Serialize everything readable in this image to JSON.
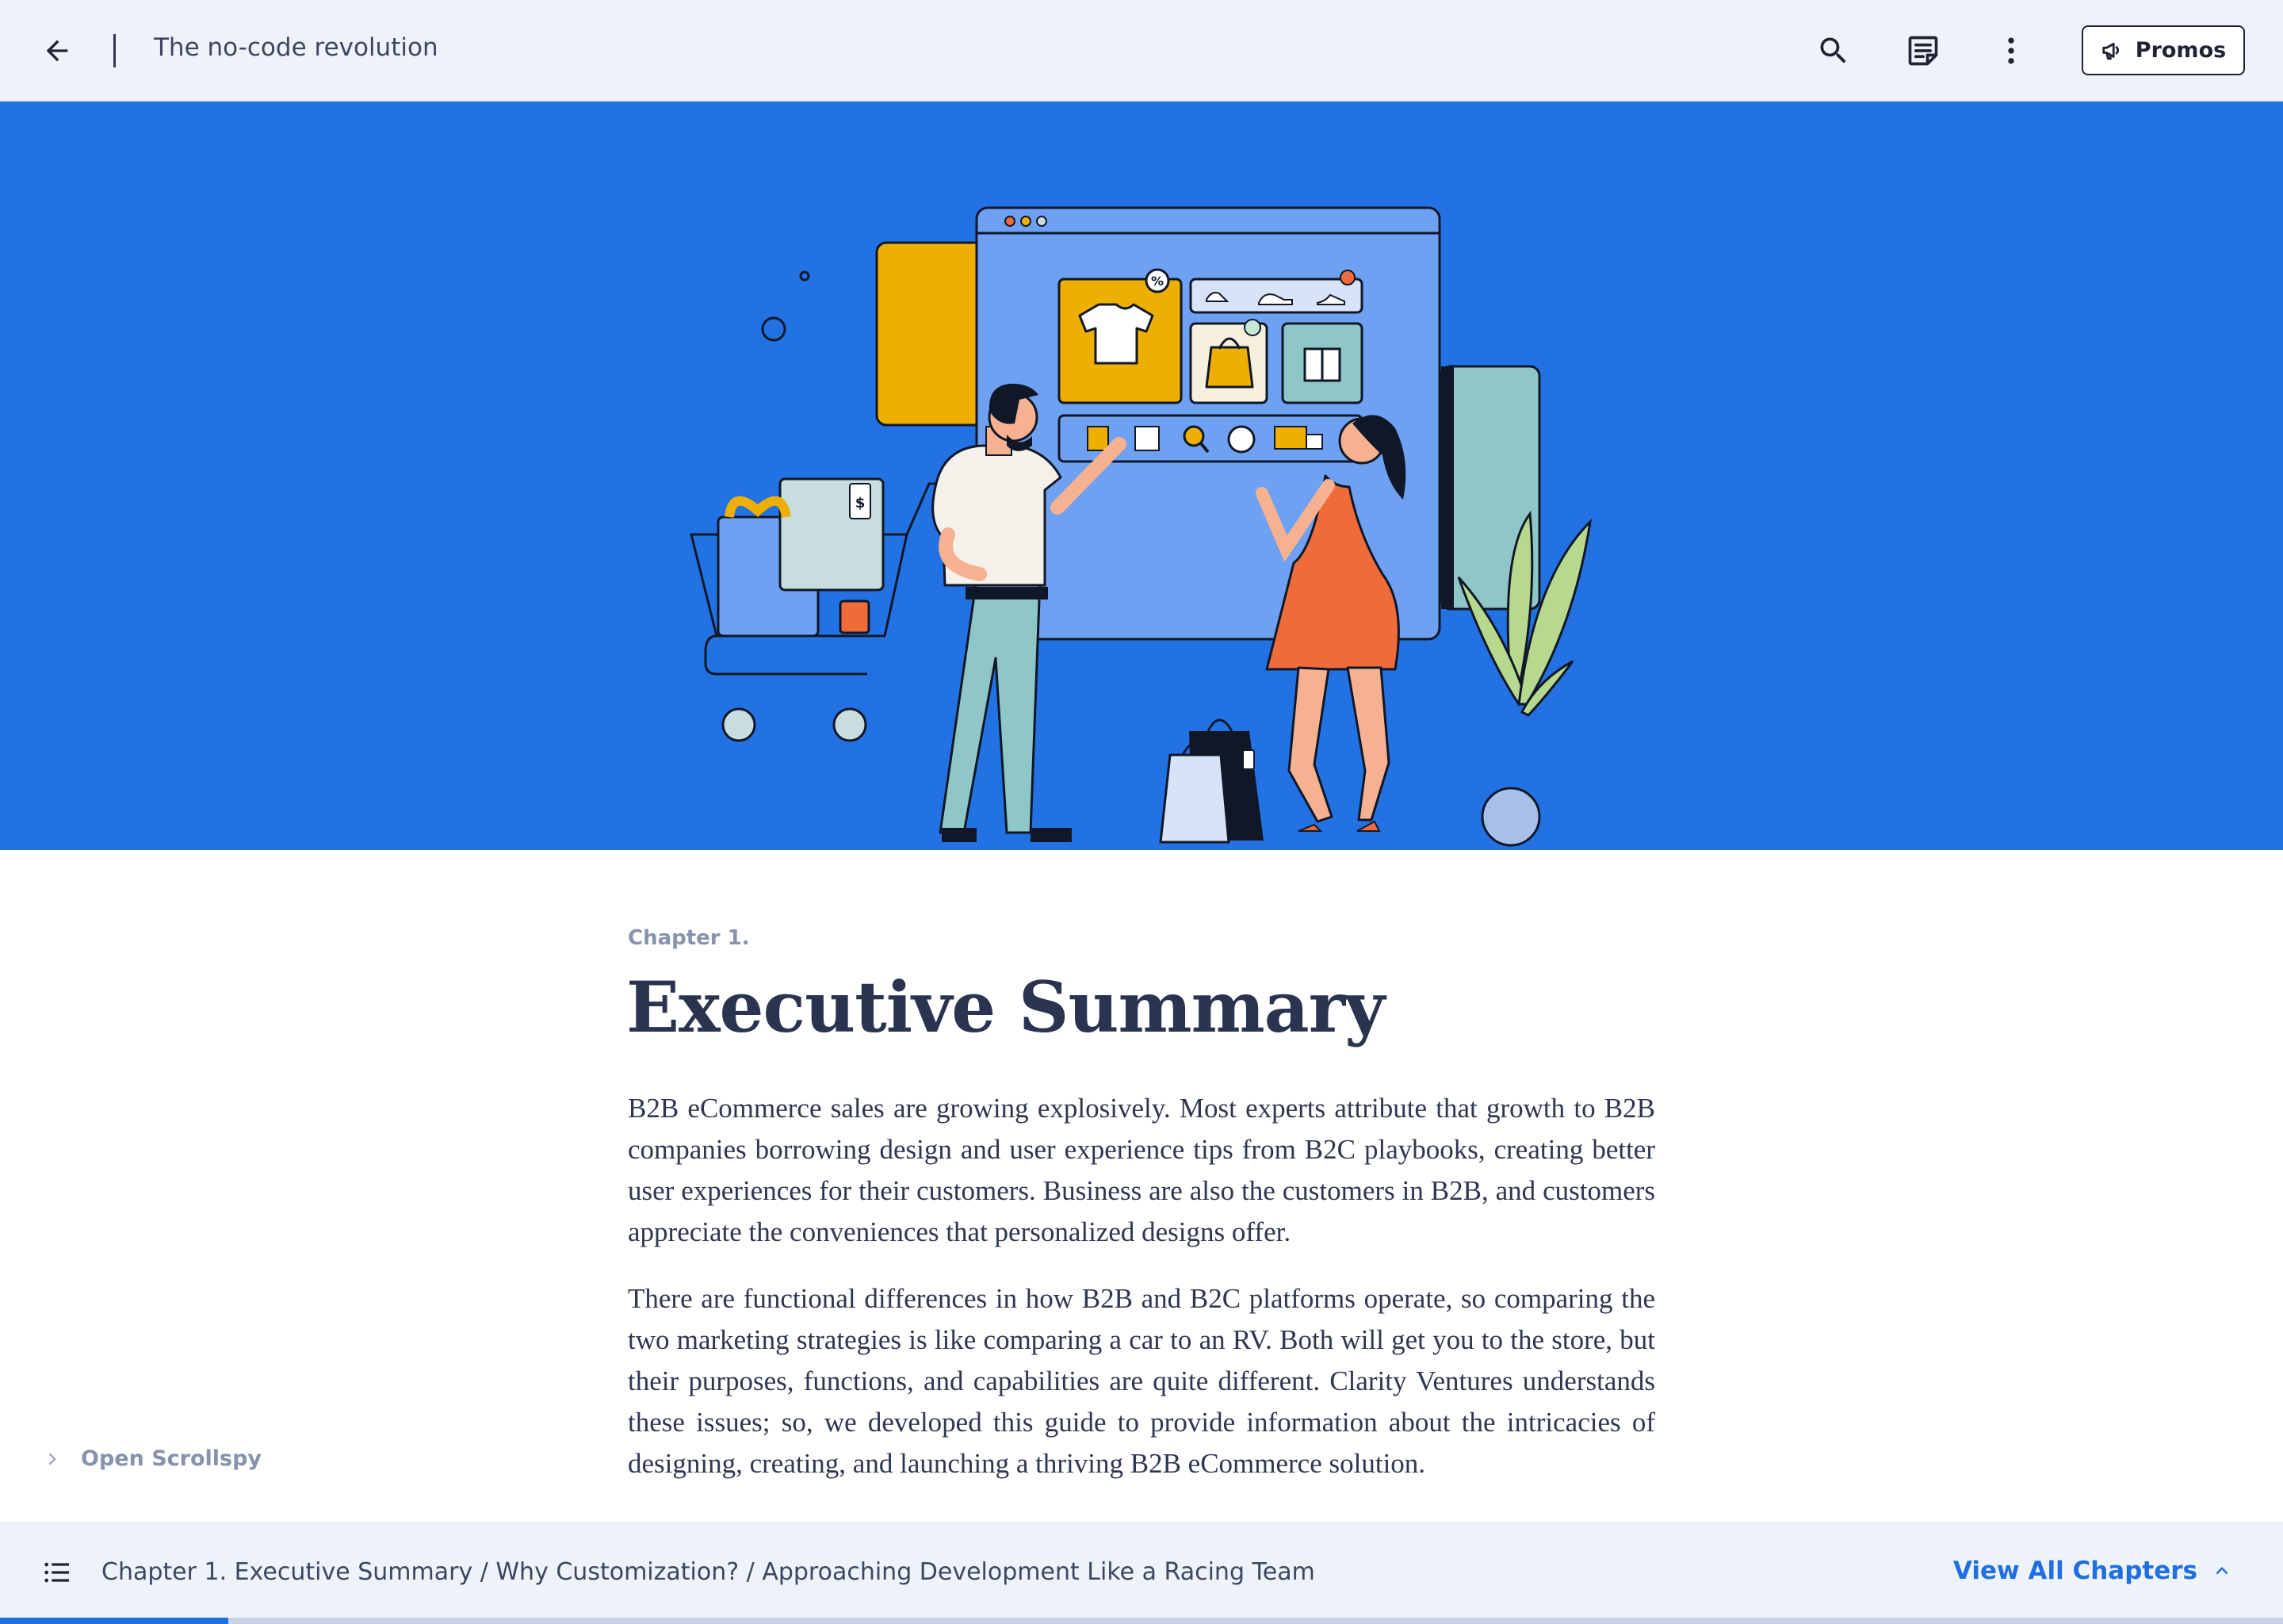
{
  "topbar": {
    "doc_title": "The no-code revolution",
    "promos_label": "Promos",
    "icons": [
      "arrow-left-icon",
      "search-icon",
      "notes-icon",
      "more-vert-icon",
      "megaphone-icon"
    ]
  },
  "hero": {
    "background_color": "#2372e3",
    "illustration": "online-shopping-illustration",
    "price_tag_symbol": "$",
    "discount_badge": "%"
  },
  "content": {
    "chapter_label": "Chapter 1.",
    "title": "Executive Summary",
    "paragraphs": [
      "B2B eCommerce sales are growing explosively. Most experts attribute that growth to B2B companies borrowing design and user experience tips from B2C playbooks, creating better user experiences for their customers. Business are also the customers in B2B, and customers appreciate the conveniences that personalized designs offer.",
      "There are functional differences in how B2B and B2C platforms operate, so comparing the two marketing strategies is like comparing a car to an RV. Both will get you to the store, but their purposes, functions, and capabilities are quite different. Clarity Ventures understands these issues; so, we developed this guide to provide information about the intricacies of designing, creating, and launching a thriving B2B eCommerce solution."
    ]
  },
  "scrollspy": {
    "label": "Open Scrollspy"
  },
  "bottombar": {
    "breadcrumb": "Chapter 1. Executive Summary / Why Customization? / Approaching Development Like a Racing Team",
    "view_all_label": "View All Chapters",
    "progress_fraction": 0.1,
    "accent_color": "#1f6fe0"
  }
}
